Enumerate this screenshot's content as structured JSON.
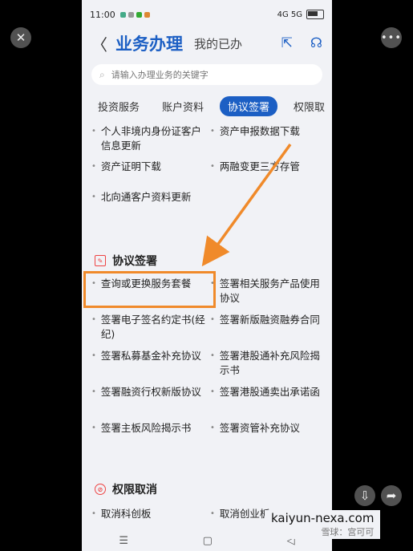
{
  "status_bar": {
    "time": "11:00",
    "indicators": "4G 5G",
    "battery": ""
  },
  "header": {
    "back_icon": "back-icon",
    "title": "业务办理",
    "subtitle": "我的已办",
    "share_icon": "share-icon",
    "service_icon": "headset-icon"
  },
  "search": {
    "placeholder": "请输入办理业务的关键字"
  },
  "tabs": [
    {
      "label": "投资服务",
      "active": false
    },
    {
      "label": "账户资料",
      "active": false
    },
    {
      "label": "协议签署",
      "active": true
    },
    {
      "label": "权限取",
      "active": false
    }
  ],
  "account_items": [
    "个人非境内身份证客户信息更新",
    "资产申报数据下载",
    "资产证明下载",
    "两融变更三方存管",
    "北向通客户资料更新"
  ],
  "agreement_section": {
    "title": "协议签署",
    "items": [
      "查询或更换服务套餐",
      "签署相关服务产品使用协议",
      "签署电子签名约定书(经纪)",
      "签署新版融资融券合同",
      "签署私募基金补充协议",
      "签署港股通补充风险揭示书",
      "签署融资行权新版协议",
      "签署港股通卖出承诺函",
      "签署主板风险揭示书",
      "签署资管补充协议"
    ]
  },
  "permission_section": {
    "title": "权限取消",
    "items": [
      "取消科创板",
      "取消创业板"
    ]
  },
  "watermark": {
    "line1": "kaiyun-nexa.com",
    "line2": "雪球：宫可可"
  },
  "colors": {
    "accent": "#1c5fc4",
    "highlight": "#f08a2a",
    "section_icon": "#e44444"
  }
}
